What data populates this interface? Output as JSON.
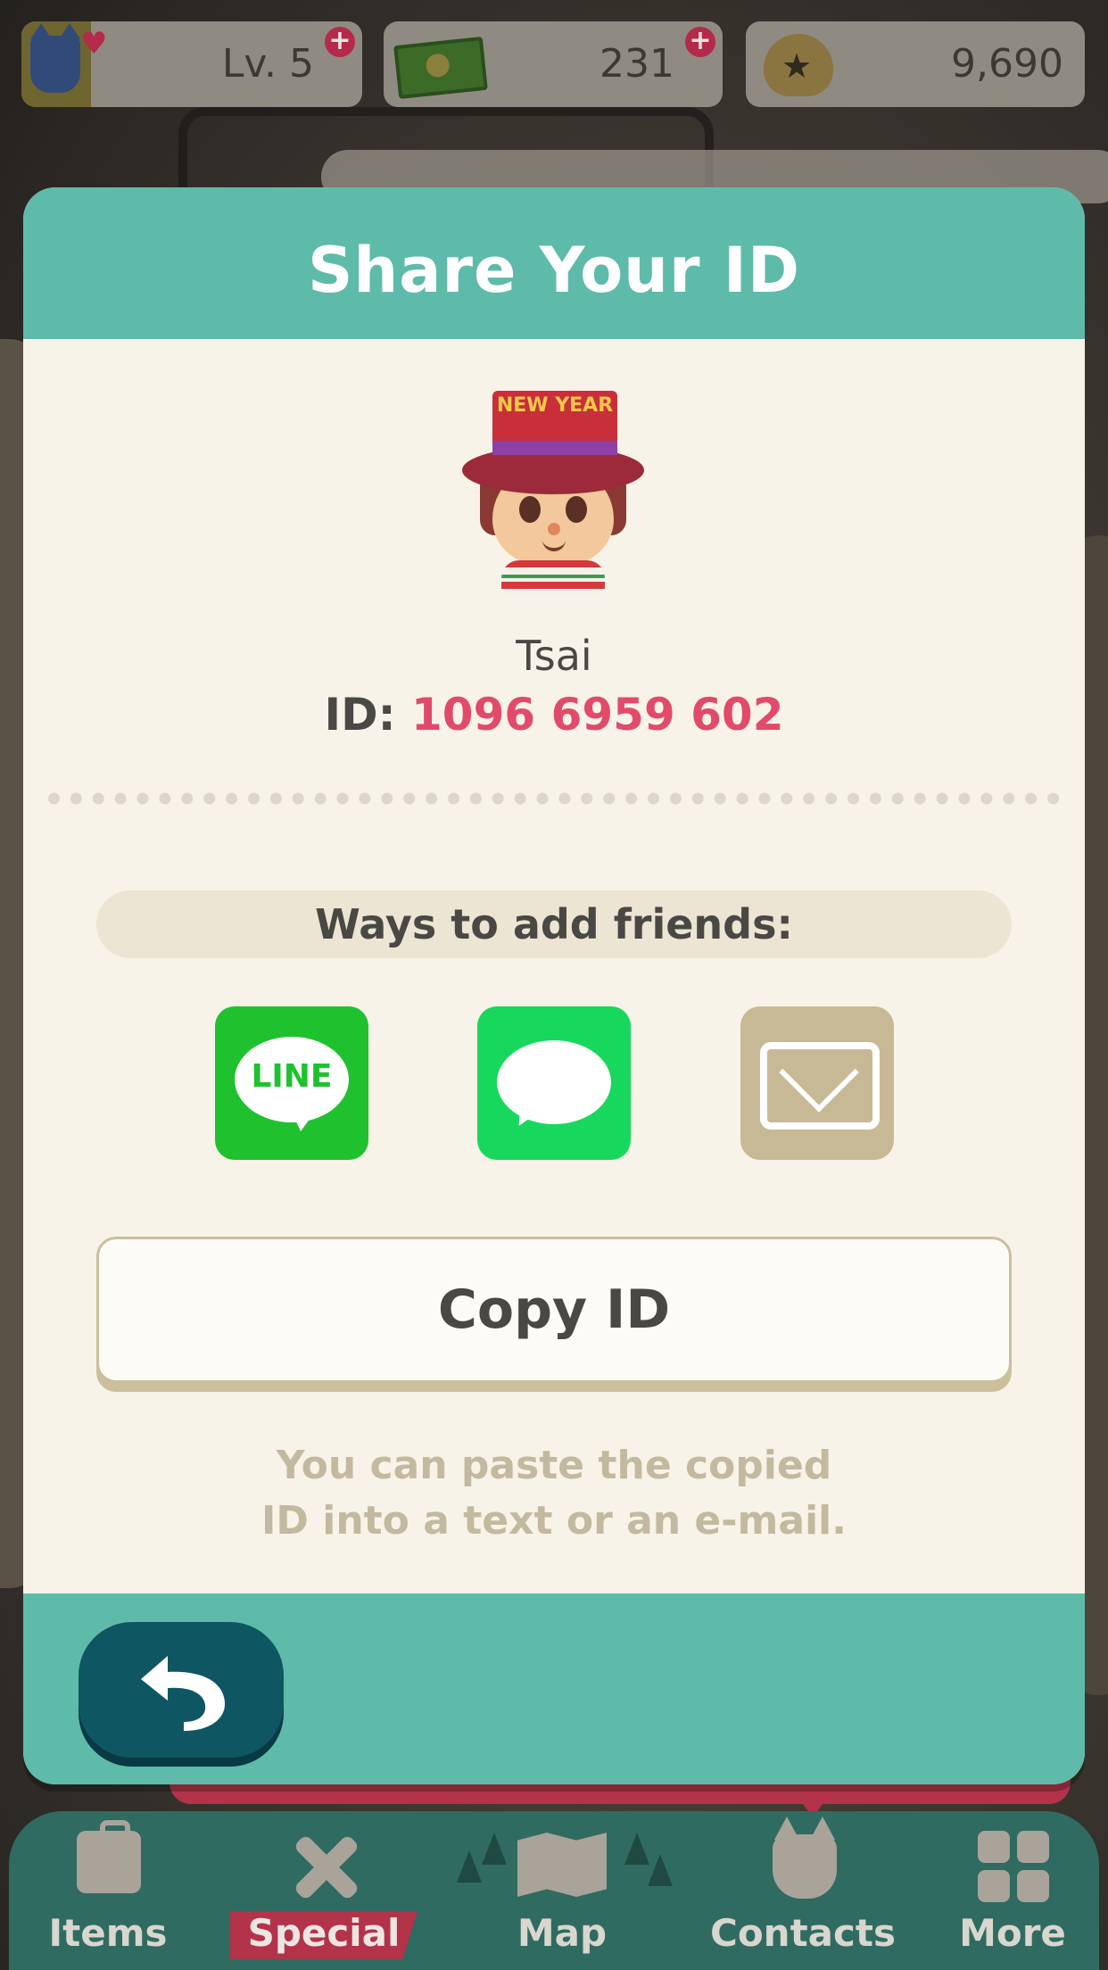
{
  "status_bar": {
    "level": "Lv. 5",
    "tickets": "231",
    "bells": "9,690"
  },
  "dialog": {
    "title": "Share Your ID",
    "hat_text": "NEW YEAR",
    "player_name": "Tsai",
    "id_label": "ID:",
    "id_value": "1096 6959 602",
    "ways_label": "Ways to add friends:",
    "share_options": [
      {
        "name": "LINE",
        "icon": "line-icon",
        "color": "#1fc12f"
      },
      {
        "name": "Messages",
        "icon": "message-bubble-icon",
        "color": "#17d85c"
      },
      {
        "name": "Mail",
        "icon": "envelope-icon",
        "color": "#c8b996"
      }
    ],
    "copy_button": "Copy ID",
    "hint_line1": "You can paste the copied",
    "hint_line2": "ID into a text or an e-mail.",
    "back_icon": "back-arrow-icon"
  },
  "bottom_nav": {
    "items": [
      {
        "label": "Items",
        "icon": "bag-icon"
      },
      {
        "label": "Special",
        "icon": "tools-icon"
      },
      {
        "label": "Map",
        "icon": "map-icon"
      },
      {
        "label": "Contacts",
        "icon": "cat-icon"
      },
      {
        "label": "More",
        "icon": "grid-icon"
      }
    ]
  },
  "colors": {
    "teal": "#5ebba9",
    "cream": "#f8f3e8",
    "id_pink": "#e14b69",
    "back_button": "#0f5663"
  }
}
